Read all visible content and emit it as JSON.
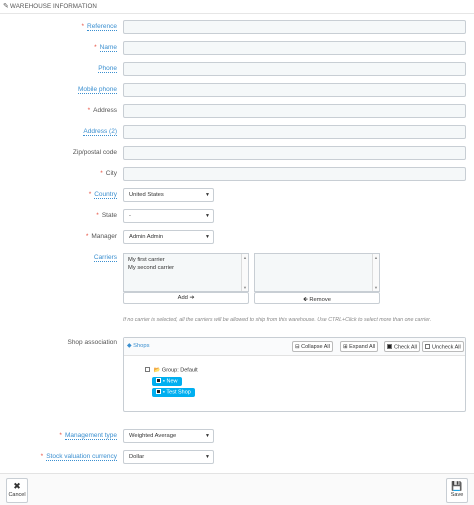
{
  "header": {
    "title": "WAREHOUSE INFORMATION",
    "icon": "pencil-icon"
  },
  "fields": {
    "reference": {
      "label": "Reference",
      "required": true,
      "tooltip": true,
      "value": ""
    },
    "name": {
      "label": "Name",
      "required": true,
      "tooltip": true,
      "value": ""
    },
    "phone": {
      "label": "Phone",
      "required": false,
      "tooltip": true,
      "value": ""
    },
    "mobile_phone": {
      "label": "Mobile phone",
      "required": false,
      "tooltip": true,
      "value": ""
    },
    "address": {
      "label": "Address",
      "required": true,
      "tooltip": false,
      "value": ""
    },
    "address2": {
      "label": "Address (2)",
      "required": false,
      "tooltip": true,
      "value": ""
    },
    "zip": {
      "label": "Zip/postal code",
      "required": false,
      "tooltip": false,
      "value": ""
    },
    "city": {
      "label": "City",
      "required": true,
      "tooltip": false,
      "value": ""
    }
  },
  "selects": {
    "country": {
      "label": "Country",
      "value": "United States"
    },
    "state": {
      "label": "State",
      "value": "-"
    },
    "manager": {
      "label": "Manager",
      "value": "Admin Admin"
    },
    "management_type": {
      "label": "Management type",
      "value": "Weighted Average"
    },
    "stock_currency": {
      "label": "Stock valuation currency",
      "value": "Dollar"
    }
  },
  "carriers": {
    "label": "Carriers",
    "available": [
      "My first carrier",
      "My second carrier"
    ],
    "selected": [],
    "add_label": "Add",
    "remove_label": "Remove",
    "hint": "If no carrier is selected, all the carriers will be allowed to ship from this warehouse. Use CTRL+Click to select more than one carrier."
  },
  "shop_association": {
    "label": "Shop association",
    "tree_title": "Shops",
    "collapse_all": "Collapse All",
    "expand_all": "Expand All",
    "check_all": "Check All",
    "uncheck_all": "Uncheck All",
    "group_label": "Group: Default",
    "shops": [
      {
        "name": "New",
        "checked": true
      },
      {
        "name": "Test Shop",
        "checked": true
      }
    ]
  },
  "footer": {
    "cancel_label": "Cancel",
    "save_label": "Save"
  },
  "colors": {
    "accent": "#00aff0",
    "required": "#e74c3c",
    "link": "#3a8fd0"
  }
}
